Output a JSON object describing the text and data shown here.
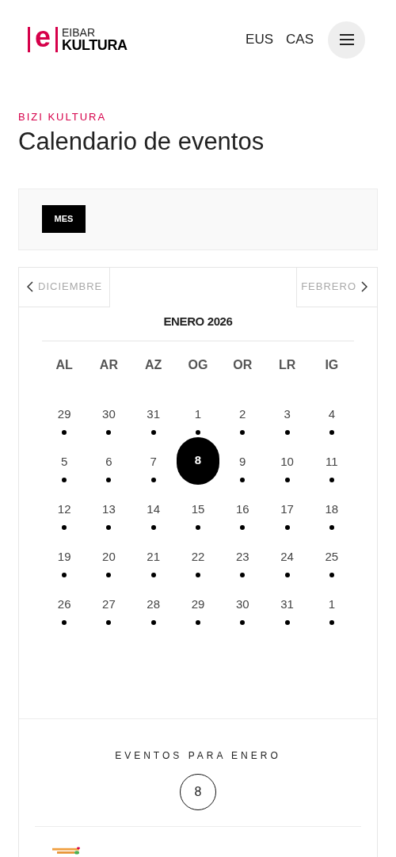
{
  "header": {
    "logo": {
      "mark": "e",
      "line1": "EIBAR",
      "line2": "KULTURA"
    },
    "languages": [
      {
        "label": "EUS"
      },
      {
        "label": "CAS"
      }
    ]
  },
  "eyebrow": "BIZI KULTURA",
  "title": "Calendario de eventos",
  "views": [
    {
      "label": "MES",
      "selected": true
    }
  ],
  "calendar": {
    "prev": "DICIEMBRE",
    "next": "FEBRERO",
    "month": "ENERO 2026",
    "weekdays": [
      "AL",
      "AR",
      "AZ",
      "OG",
      "OR",
      "LR",
      "IG"
    ],
    "weeks": [
      [
        {
          "day": "29",
          "has_events": true,
          "selected": false
        },
        {
          "day": "30",
          "has_events": true,
          "selected": false
        },
        {
          "day": "31",
          "has_events": true,
          "selected": false
        },
        {
          "day": "1",
          "has_events": true,
          "selected": false
        },
        {
          "day": "2",
          "has_events": true,
          "selected": false
        },
        {
          "day": "3",
          "has_events": true,
          "selected": false
        },
        {
          "day": "4",
          "has_events": true,
          "selected": false
        }
      ],
      [
        {
          "day": "5",
          "has_events": true,
          "selected": false
        },
        {
          "day": "6",
          "has_events": true,
          "selected": false
        },
        {
          "day": "7",
          "has_events": true,
          "selected": false
        },
        {
          "day": "8",
          "has_events": false,
          "selected": true
        },
        {
          "day": "9",
          "has_events": true,
          "selected": false
        },
        {
          "day": "10",
          "has_events": true,
          "selected": false
        },
        {
          "day": "11",
          "has_events": true,
          "selected": false
        }
      ],
      [
        {
          "day": "12",
          "has_events": true,
          "selected": false
        },
        {
          "day": "13",
          "has_events": true,
          "selected": false
        },
        {
          "day": "14",
          "has_events": true,
          "selected": false
        },
        {
          "day": "15",
          "has_events": true,
          "selected": false
        },
        {
          "day": "16",
          "has_events": true,
          "selected": false
        },
        {
          "day": "17",
          "has_events": true,
          "selected": false
        },
        {
          "day": "18",
          "has_events": true,
          "selected": false
        }
      ],
      [
        {
          "day": "19",
          "has_events": true,
          "selected": false
        },
        {
          "day": "20",
          "has_events": true,
          "selected": false
        },
        {
          "day": "21",
          "has_events": true,
          "selected": false
        },
        {
          "day": "22",
          "has_events": true,
          "selected": false
        },
        {
          "day": "23",
          "has_events": true,
          "selected": false
        },
        {
          "day": "24",
          "has_events": true,
          "selected": false
        },
        {
          "day": "25",
          "has_events": true,
          "selected": false
        }
      ],
      [
        {
          "day": "26",
          "has_events": true,
          "selected": false
        },
        {
          "day": "27",
          "has_events": true,
          "selected": false
        },
        {
          "day": "28",
          "has_events": true,
          "selected": false
        },
        {
          "day": "29",
          "has_events": true,
          "selected": false
        },
        {
          "day": "30",
          "has_events": true,
          "selected": false
        },
        {
          "day": "31",
          "has_events": true,
          "selected": false
        },
        {
          "day": "1",
          "has_events": true,
          "selected": false
        }
      ]
    ]
  },
  "events": {
    "heading": "EVENTOS PARA ENERO",
    "day": "8"
  }
}
